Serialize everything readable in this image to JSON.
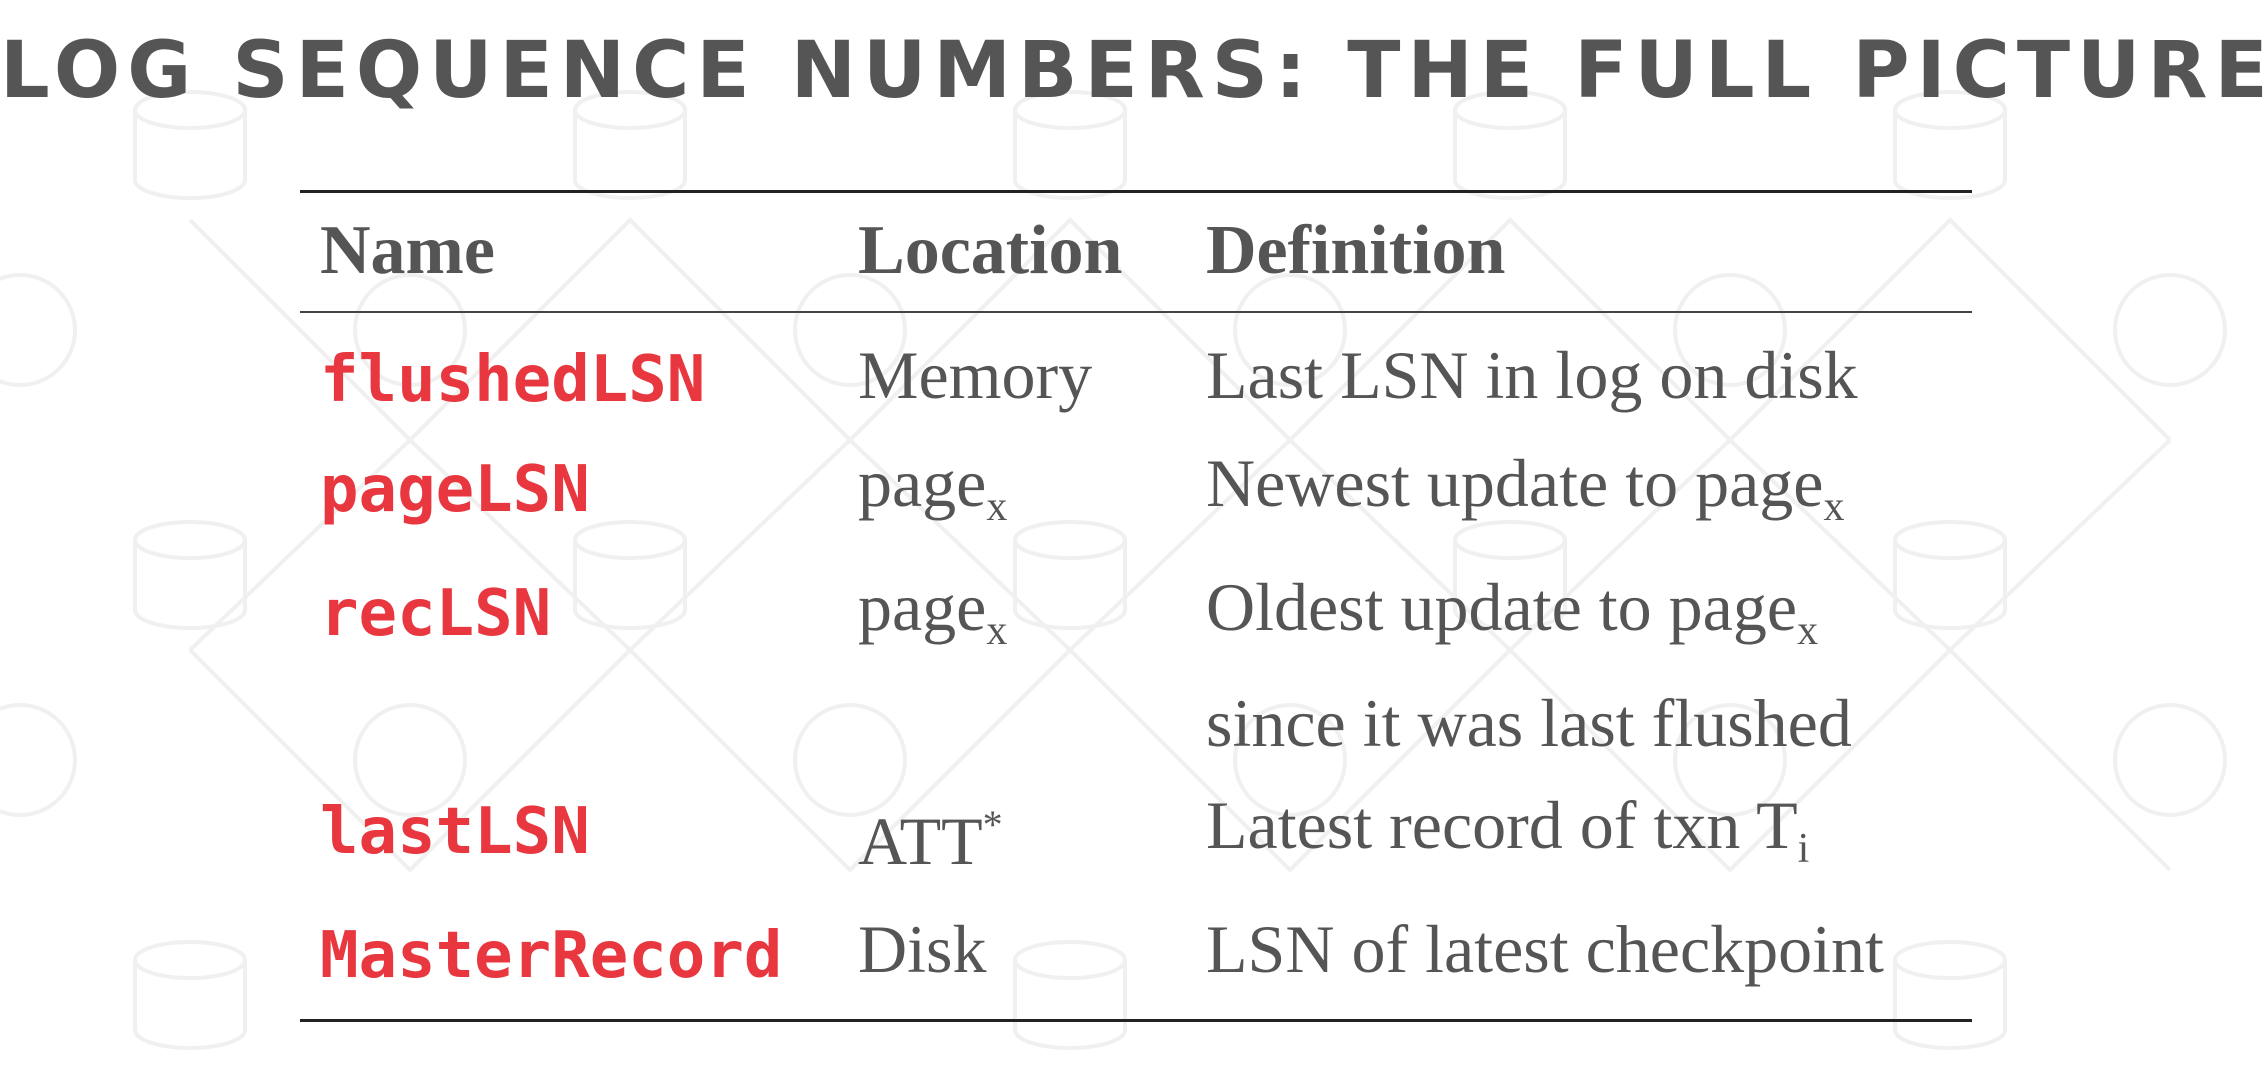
{
  "title": "LOG SEQUENCE NUMBERS: THE FULL PICTURE",
  "columns": [
    "Name",
    "Location",
    "Definition"
  ],
  "rows": [
    {
      "name": "flushedLSN",
      "location": "Memory",
      "location_sub": "",
      "location_sup": "",
      "definition": "Last LSN in log on disk",
      "definition_sub": "",
      "definition_line2": ""
    },
    {
      "name": "pageLSN",
      "location": "page",
      "location_sub": "x",
      "location_sup": "",
      "definition": "Newest update to page",
      "definition_sub": "x",
      "definition_line2": ""
    },
    {
      "name": "recLSN",
      "location": "page",
      "location_sub": "x",
      "location_sup": "",
      "definition": "Oldest update to page",
      "definition_sub": "x",
      "definition_line2": "since it was last flushed"
    },
    {
      "name": "lastLSN",
      "location": "ATT",
      "location_sub": "",
      "location_sup": "*",
      "definition": "Latest record of txn T",
      "definition_sub": "i",
      "definition_line2": ""
    },
    {
      "name": "MasterRecord",
      "location": "Disk",
      "location_sub": "",
      "location_sup": "",
      "definition": "LSN of latest checkpoint",
      "definition_sub": "",
      "definition_line2": ""
    }
  ],
  "colors": {
    "title": "#555555",
    "name": "#e8373f",
    "text": "#555555",
    "rule": "#222222"
  }
}
